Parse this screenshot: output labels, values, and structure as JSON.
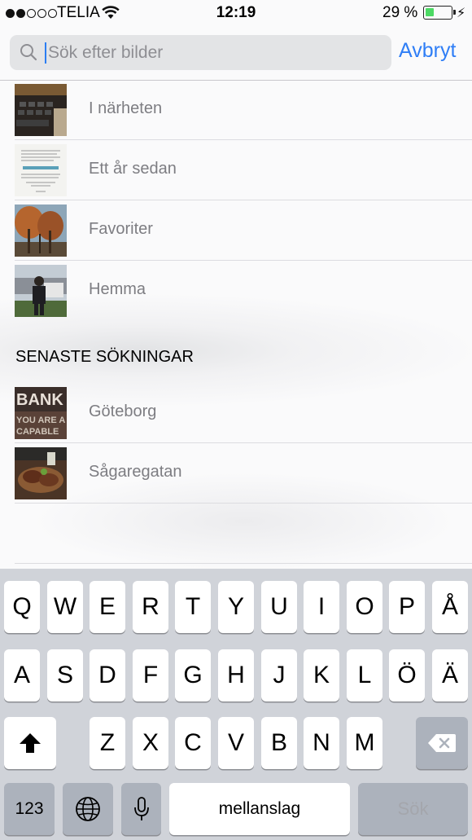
{
  "status_bar": {
    "carrier": "TELIA",
    "time": "12:19",
    "battery_percent": "29 %",
    "battery_level": 0.29,
    "signal_bars_filled": 2,
    "signal_bars_total": 5
  },
  "search": {
    "placeholder": "Sök efter bilder",
    "value": "",
    "cancel_label": "Avbryt"
  },
  "suggestions": [
    {
      "label": "I närheten",
      "thumb": "laptop-keyboard-photo"
    },
    {
      "label": "Ett år sedan",
      "thumb": "document-photo"
    },
    {
      "label": "Favoriter",
      "thumb": "autumn-trees-photo"
    },
    {
      "label": "Hemma",
      "thumb": "person-in-yard-photo"
    }
  ],
  "recent_header": "SENASTE SÖKNINGAR",
  "recent_searches": [
    {
      "label": "Göteborg",
      "thumb": "sign-photo"
    },
    {
      "label": "Sågaregatan",
      "thumb": "food-photo"
    }
  ],
  "keyboard": {
    "row1": [
      "Q",
      "W",
      "E",
      "R",
      "T",
      "Y",
      "U",
      "I",
      "O",
      "P",
      "Å"
    ],
    "row2": [
      "A",
      "S",
      "D",
      "F",
      "G",
      "H",
      "J",
      "K",
      "L",
      "Ö",
      "Ä"
    ],
    "row3": [
      "Z",
      "X",
      "C",
      "V",
      "B",
      "N",
      "M"
    ],
    "numbers_label": "123",
    "space_label": "mellanslag",
    "search_label": "Sök",
    "icons": {
      "shift": "shift-arrow-icon",
      "delete": "backspace-icon",
      "globe": "globe-icon",
      "mic": "microphone-icon"
    }
  },
  "colors": {
    "accent": "#2f7ef6",
    "battery": "#4cd964",
    "keyboard_bg": "#d0d3d9",
    "dark_key": "#acb2bc"
  }
}
